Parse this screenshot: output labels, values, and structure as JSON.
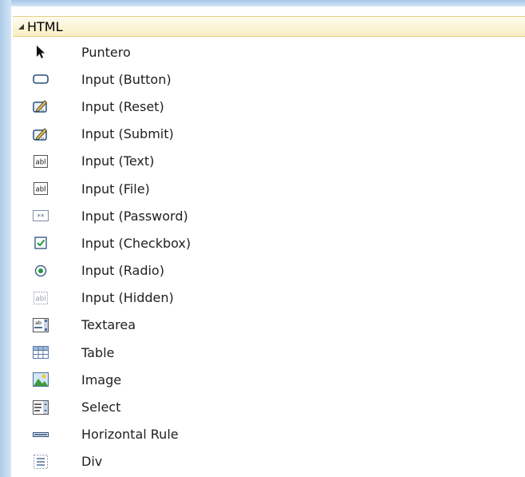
{
  "panel": {
    "group_title": "HTML",
    "items": [
      {
        "label": "Puntero",
        "icon": "pointer-icon"
      },
      {
        "label": "Input (Button)",
        "icon": "button-icon"
      },
      {
        "label": "Input (Reset)",
        "icon": "reset-icon"
      },
      {
        "label": "Input (Submit)",
        "icon": "submit-icon"
      },
      {
        "label": "Input (Text)",
        "icon": "textbox-icon"
      },
      {
        "label": "Input (File)",
        "icon": "file-input-icon"
      },
      {
        "label": "Input (Password)",
        "icon": "password-icon"
      },
      {
        "label": "Input (Checkbox)",
        "icon": "checkbox-icon"
      },
      {
        "label": "Input (Radio)",
        "icon": "radio-icon"
      },
      {
        "label": "Input (Hidden)",
        "icon": "hidden-input-icon"
      },
      {
        "label": "Textarea",
        "icon": "textarea-icon"
      },
      {
        "label": "Table",
        "icon": "table-icon"
      },
      {
        "label": "Image",
        "icon": "image-icon"
      },
      {
        "label": "Select",
        "icon": "select-icon"
      },
      {
        "label": "Horizontal Rule",
        "icon": "horizontal-rule-icon"
      },
      {
        "label": "Div",
        "icon": "div-icon"
      }
    ]
  }
}
